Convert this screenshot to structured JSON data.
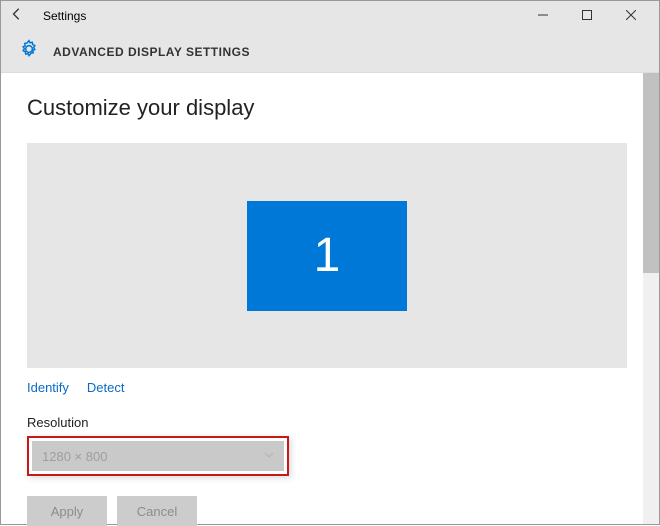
{
  "titlebar": {
    "back_icon": "back",
    "title": "Settings"
  },
  "header": {
    "title": "ADVANCED DISPLAY SETTINGS"
  },
  "main": {
    "heading": "Customize your display",
    "monitor_number": "1",
    "identify_label": "Identify",
    "detect_label": "Detect",
    "resolution_label": "Resolution",
    "resolution_value": "1280 × 800",
    "apply_label": "Apply",
    "cancel_label": "Cancel"
  }
}
